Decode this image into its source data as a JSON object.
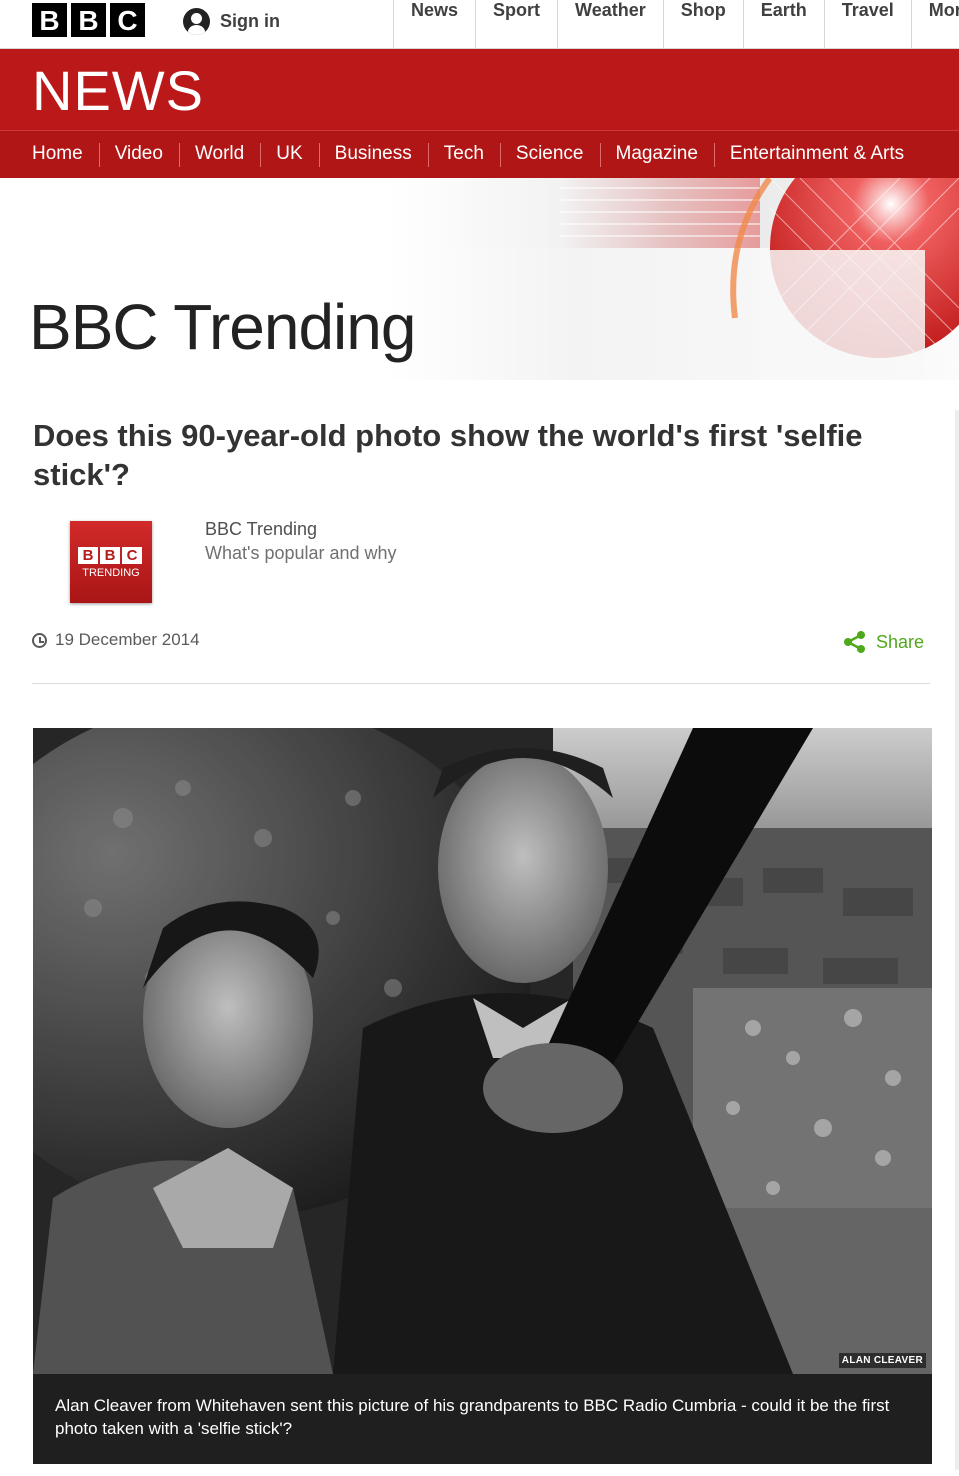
{
  "top": {
    "logo_letters": [
      "B",
      "B",
      "C"
    ],
    "signin": "Sign in",
    "nav": [
      "News",
      "Sport",
      "Weather",
      "Shop",
      "Earth",
      "Travel",
      "Mor"
    ]
  },
  "news": {
    "title": "NEWS",
    "sections": [
      "Home",
      "Video",
      "World",
      "UK",
      "Business",
      "Tech",
      "Science",
      "Magazine",
      "Entertainment & Arts"
    ]
  },
  "banner": {
    "title": "BBC Trending"
  },
  "article": {
    "headline": "Does this 90-year-old photo show the world's first 'selfie stick'?",
    "author_badge": {
      "letters": [
        "B",
        "B",
        "C"
      ],
      "label": "TRENDING"
    },
    "author_name": "BBC Trending",
    "author_desc": "What's popular and why",
    "date": "19 December 2014",
    "share": "Share",
    "photo_credit": "ALAN CLEAVER",
    "caption": "Alan Cleaver from Whitehaven sent this picture of his grandparents to BBC Radio Cumbria - could it be the first photo taken with a 'selfie stick'?"
  },
  "colors": {
    "brand_red": "#bb1919",
    "share_green": "#4fa91c"
  }
}
